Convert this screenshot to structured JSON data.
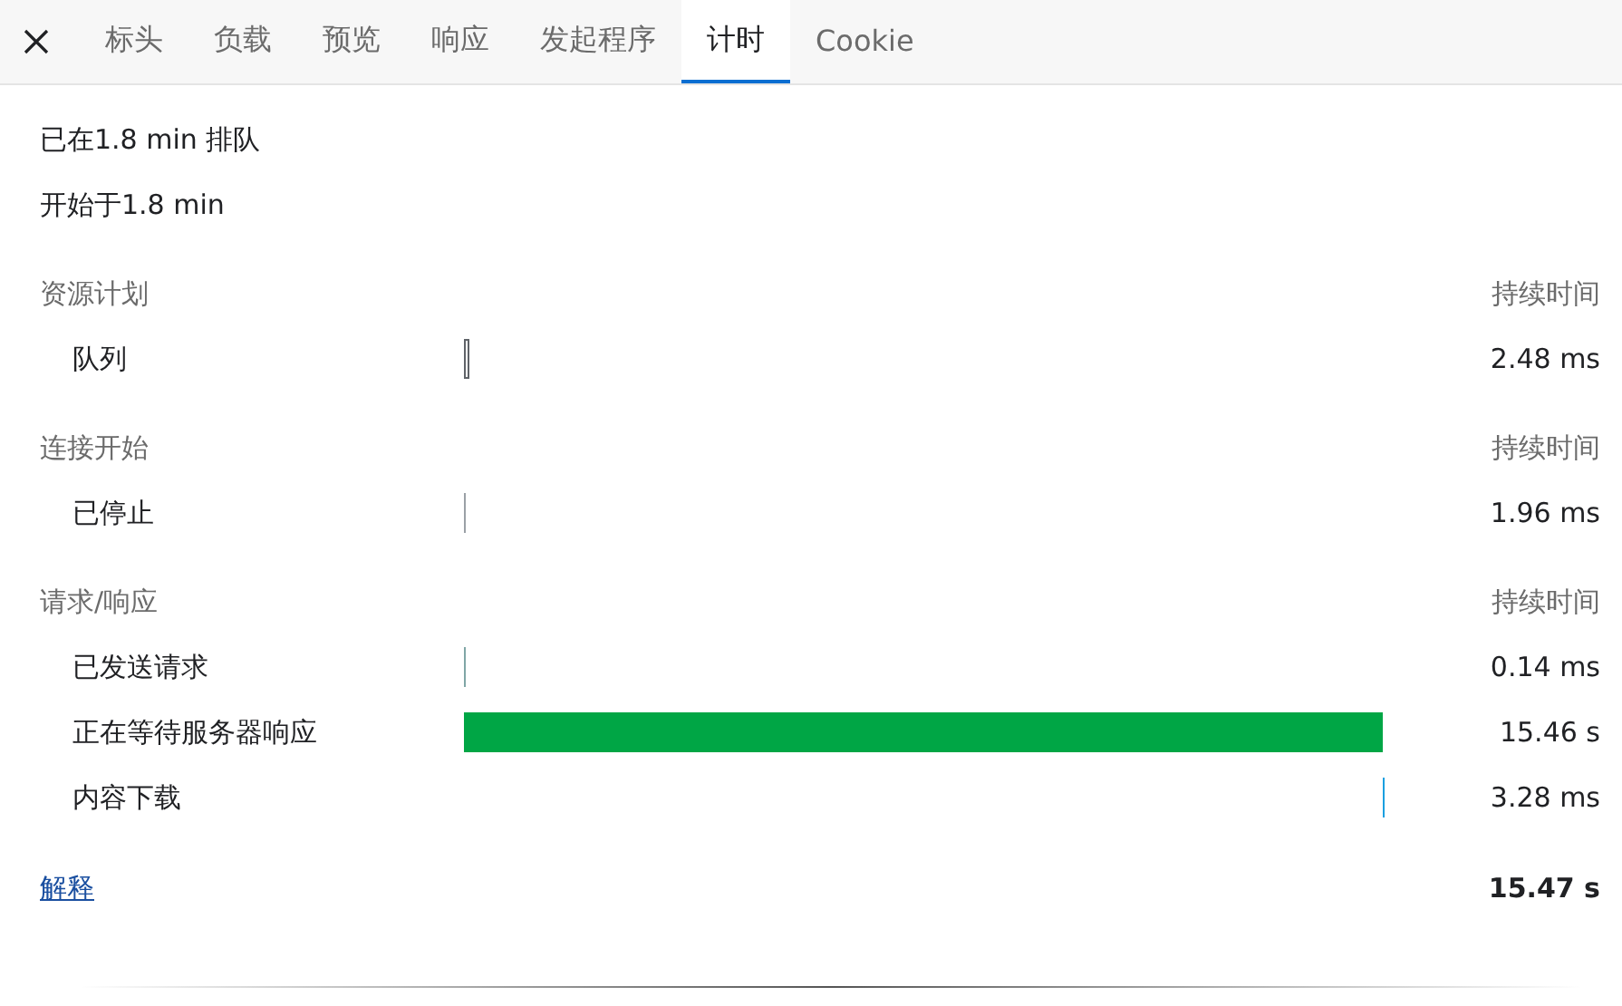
{
  "tabs": [
    {
      "label": "标头",
      "selected": false
    },
    {
      "label": "负载",
      "selected": false
    },
    {
      "label": "预览",
      "selected": false
    },
    {
      "label": "响应",
      "selected": false
    },
    {
      "label": "发起程序",
      "selected": false
    },
    {
      "label": "计时",
      "selected": true
    },
    {
      "label": "Cookie",
      "selected": false
    }
  ],
  "summary": [
    "已在1.8 min 排队",
    "开始于1.8 min"
  ],
  "sections": [
    {
      "title": "资源计划",
      "duration_heading": "持续时间",
      "rows": [
        {
          "label": "队列",
          "kind": "outlined",
          "color": "#5f6368",
          "duration": "2.48 ms"
        }
      ]
    },
    {
      "title": "连接开始",
      "duration_heading": "持续时间",
      "rows": [
        {
          "label": "已停止",
          "kind": "tick-start",
          "color": "#9aa0a6",
          "duration": "1.96 ms"
        }
      ]
    },
    {
      "title": "请求/响应",
      "duration_heading": "持续时间",
      "rows": [
        {
          "label": "已发送请求",
          "kind": "tick-start",
          "color": "#7fa6a6",
          "duration": "0.14 ms"
        },
        {
          "label": "正在等待服务器响应",
          "kind": "span",
          "color": "#00a645",
          "duration": "15.46 s"
        },
        {
          "label": "内容下载",
          "kind": "tick-end",
          "color": "#1a9fe0",
          "duration": "3.28 ms"
        }
      ]
    }
  ],
  "footer": {
    "link": "解释",
    "total": "15.47 s"
  }
}
